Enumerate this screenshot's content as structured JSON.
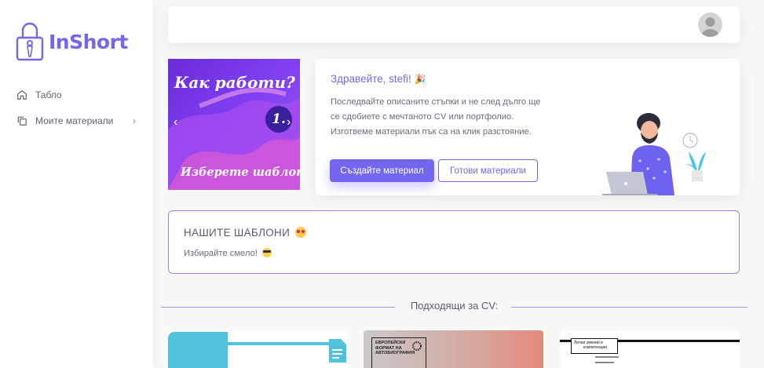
{
  "brand": {
    "name": "InShort"
  },
  "sidebar": {
    "items": [
      {
        "label": "Табло",
        "icon": "home-icon"
      },
      {
        "label": "Моите материали",
        "icon": "copy-icon"
      }
    ]
  },
  "carousel": {
    "title": "Как работи?",
    "step": "1.",
    "subtitle": "Изберете шаблон"
  },
  "welcome": {
    "greeting": "Здравейте, stefi!",
    "text": "Последвайте описаните стъпки и не след дълго ще се сдобиете с мечтаното CV или портфолио. Изготвеме материали пък са на клик разстояние.",
    "primary_button": "Създайте материал",
    "secondary_button": "Готови материали"
  },
  "templates": {
    "title": "НАШИТЕ ШАБЛОНИ",
    "subtitle": "Избирайте смело!"
  },
  "section": {
    "label": "Подходящи за CV:"
  },
  "thumbs": {
    "t2": {
      "line1": "ЕВРОПЕЙСКИ",
      "line2": "ФОРМАТ НА",
      "line3": "АВТОБИОГРАФИЯ"
    },
    "t3": {
      "line1": "Лични умения и",
      "line2": "компетенции"
    }
  },
  "colors": {
    "accent": "#7367f0",
    "text": "#5e5873",
    "background": "#f8f8f8"
  }
}
